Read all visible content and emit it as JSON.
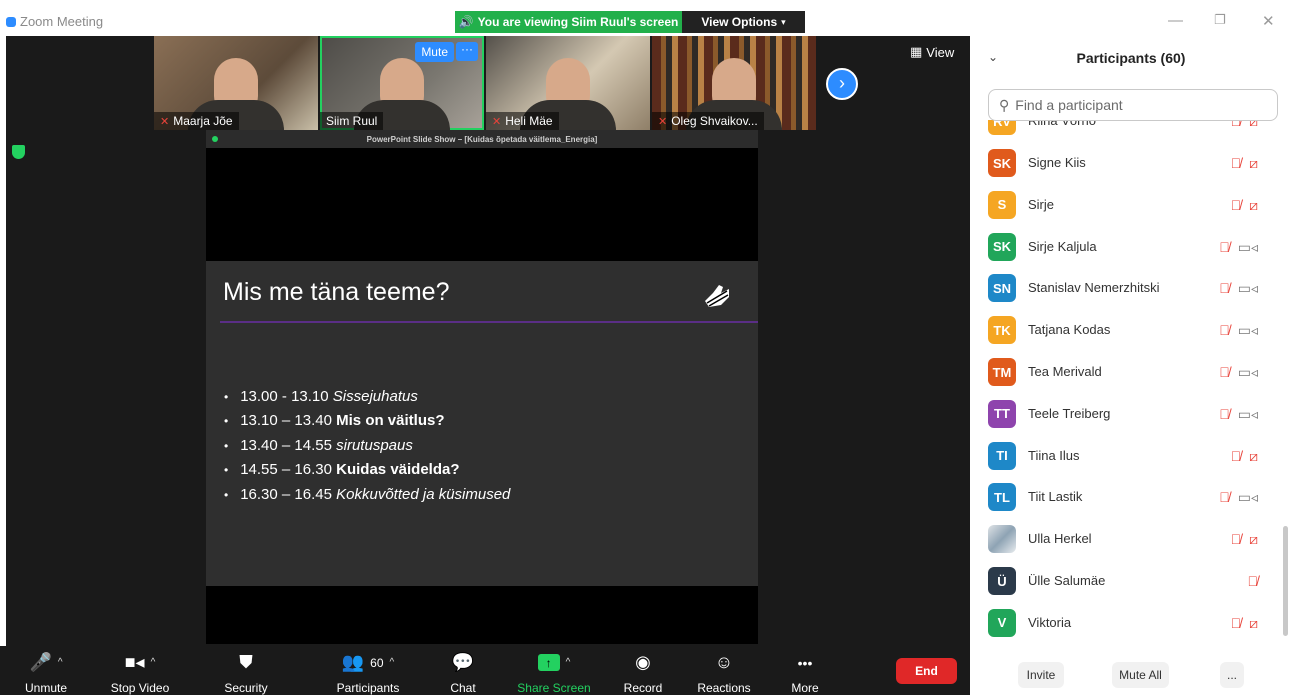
{
  "window": {
    "app_title": "Zoom Meeting",
    "viewing_banner": "You are viewing Siim Ruul's screen",
    "view_options": "View Options"
  },
  "thumbnails": [
    {
      "name": "Maarja Jõe",
      "muted": true
    },
    {
      "name": "Siim Ruul",
      "muted": false,
      "mute_label": "Mute",
      "more_label": "···"
    },
    {
      "name": "Heli Mäe",
      "muted": true
    },
    {
      "name": "Oleg Shvaikov...",
      "muted": true
    }
  ],
  "view_button": "View",
  "slide": {
    "window_title": "PowerPoint Slide Show – [Kuidas õpetada väitlema_Energia]",
    "title": "Mis me täna teeme?",
    "bullets": [
      {
        "time": "13.00 - 13.10",
        "topic": "Sissejuhatus",
        "style": "italic"
      },
      {
        "time": "13.10 – 13.40",
        "topic": "Mis on väitlus?",
        "style": "bold"
      },
      {
        "time": "13.40 – 14.55",
        "topic": "sirutuspaus",
        "style": "italic"
      },
      {
        "time": "14.55 – 16.30",
        "topic": "Kuidas väidelda?",
        "style": "bold"
      },
      {
        "time": "16.30 – 16.45",
        "topic": "Kokkuvõtted ja küsimused",
        "style": "italic"
      }
    ]
  },
  "toolbar": {
    "unmute": "Unmute",
    "stop_video": "Stop Video",
    "security": "Security",
    "participants": "Participants",
    "participants_count": "60",
    "chat": "Chat",
    "share_screen": "Share Screen",
    "record": "Record",
    "reactions": "Reactions",
    "more": "More",
    "end": "End"
  },
  "participants_panel": {
    "title": "Participants (60)",
    "search_placeholder": "Find a participant",
    "partial_top_name": "Riina Võrno",
    "partial_top_initials": "RV",
    "items": [
      {
        "initials": "SK",
        "name": "Signe Kiis",
        "color": "#E05A1C",
        "video_off": true
      },
      {
        "initials": "S",
        "name": "Sirje",
        "color": "#F5A623",
        "video_off": true
      },
      {
        "initials": "SK",
        "name": "Sirje Kaljula",
        "color": "#21A65A",
        "video_off": false
      },
      {
        "initials": "SN",
        "name": "Stanislav Nemerzhitski",
        "color": "#1E88C8",
        "video_off": false
      },
      {
        "initials": "TK",
        "name": "Tatjana Kodas",
        "color": "#F5A623",
        "video_off": false
      },
      {
        "initials": "TM",
        "name": "Tea Merivald",
        "color": "#E05A1C",
        "video_off": false
      },
      {
        "initials": "TT",
        "name": "Teele Treiberg",
        "color": "#8E44AD",
        "video_off": false
      },
      {
        "initials": "TI",
        "name": "Tiina Ilus",
        "color": "#1E88C8",
        "video_off": true
      },
      {
        "initials": "TL",
        "name": "Tiit Lastik",
        "color": "#1E88C8",
        "video_off": false
      },
      {
        "initials": "",
        "name": "Ulla Herkel",
        "color": "photo",
        "video_off": true
      },
      {
        "initials": "Ü",
        "name": "Ülle Salumäe",
        "color": "#2B3A4A",
        "video_off": null
      },
      {
        "initials": "V",
        "name": "Viktoria",
        "color": "#21A65A",
        "video_off": true
      }
    ],
    "invite": "Invite",
    "mute_all": "Mute All",
    "more": "..."
  }
}
